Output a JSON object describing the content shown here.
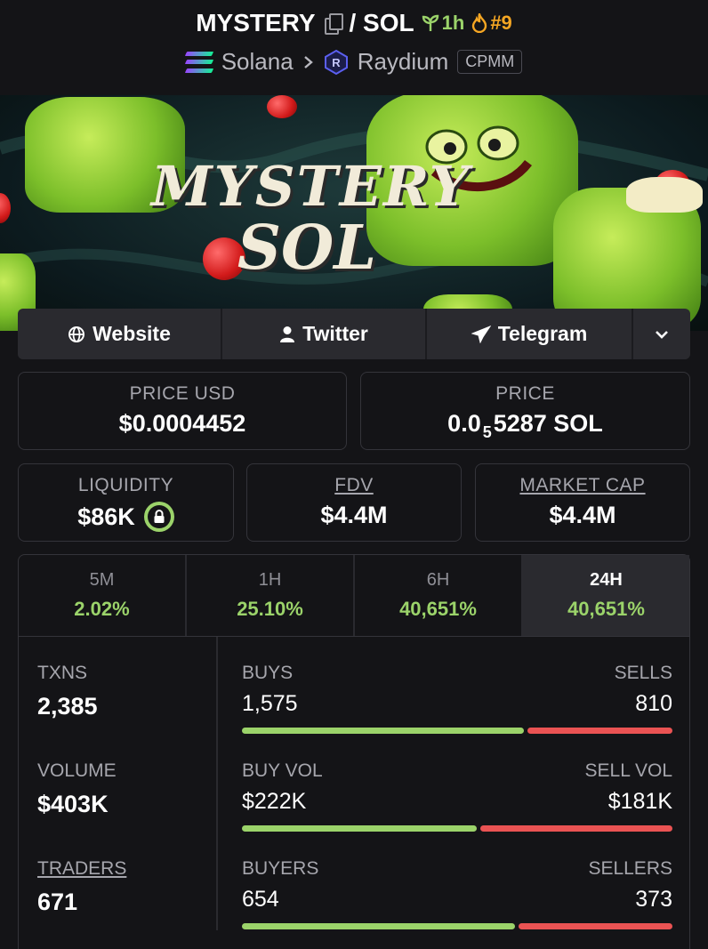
{
  "header": {
    "token": "MYSTERY",
    "pair": "/ SOL",
    "age": "1h",
    "rank": "#9",
    "chain": "Solana",
    "dex": "Raydium",
    "pool_type": "CPMM"
  },
  "banner": {
    "line1": "MYSTERY",
    "line2": "SOL"
  },
  "links": {
    "website": "Website",
    "twitter": "Twitter",
    "telegram": "Telegram"
  },
  "price": {
    "usd_label": "PRICE USD",
    "usd_value": "$0.0004452",
    "native_label": "PRICE",
    "native_prefix": "0.0",
    "native_sub": "5",
    "native_suffix": "5287 SOL"
  },
  "metrics": {
    "liquidity_label": "LIQUIDITY",
    "liquidity_value": "$86K",
    "fdv_label": "FDV",
    "fdv_value": "$4.4M",
    "mcap_label": "MARKET CAP",
    "mcap_value": "$4.4M"
  },
  "tabs": [
    {
      "label": "5M",
      "value": "2.02%"
    },
    {
      "label": "1H",
      "value": "25.10%"
    },
    {
      "label": "6H",
      "value": "40,651%"
    },
    {
      "label": "24H",
      "value": "40,651%"
    }
  ],
  "stats": {
    "txns_label": "TXNS",
    "txns_value": "2,385",
    "volume_label": "VOLUME",
    "volume_value": "$403K",
    "traders_label": "TRADERS",
    "traders_value": "671"
  },
  "bars": [
    {
      "left_label": "BUYS",
      "right_label": "SELLS",
      "left_value": "1,575",
      "right_value": "810",
      "buy_fraction": 0.66
    },
    {
      "left_label": "BUY VOL",
      "right_label": "SELL VOL",
      "left_value": "$222K",
      "right_value": "$181K",
      "buy_fraction": 0.55
    },
    {
      "left_label": "BUYERS",
      "right_label": "SELLERS",
      "left_value": "654",
      "right_value": "373",
      "buy_fraction": 0.64
    }
  ],
  "colors": {
    "positive": "#9bd36a",
    "negative": "#ea5353",
    "rank": "#f5a623"
  }
}
